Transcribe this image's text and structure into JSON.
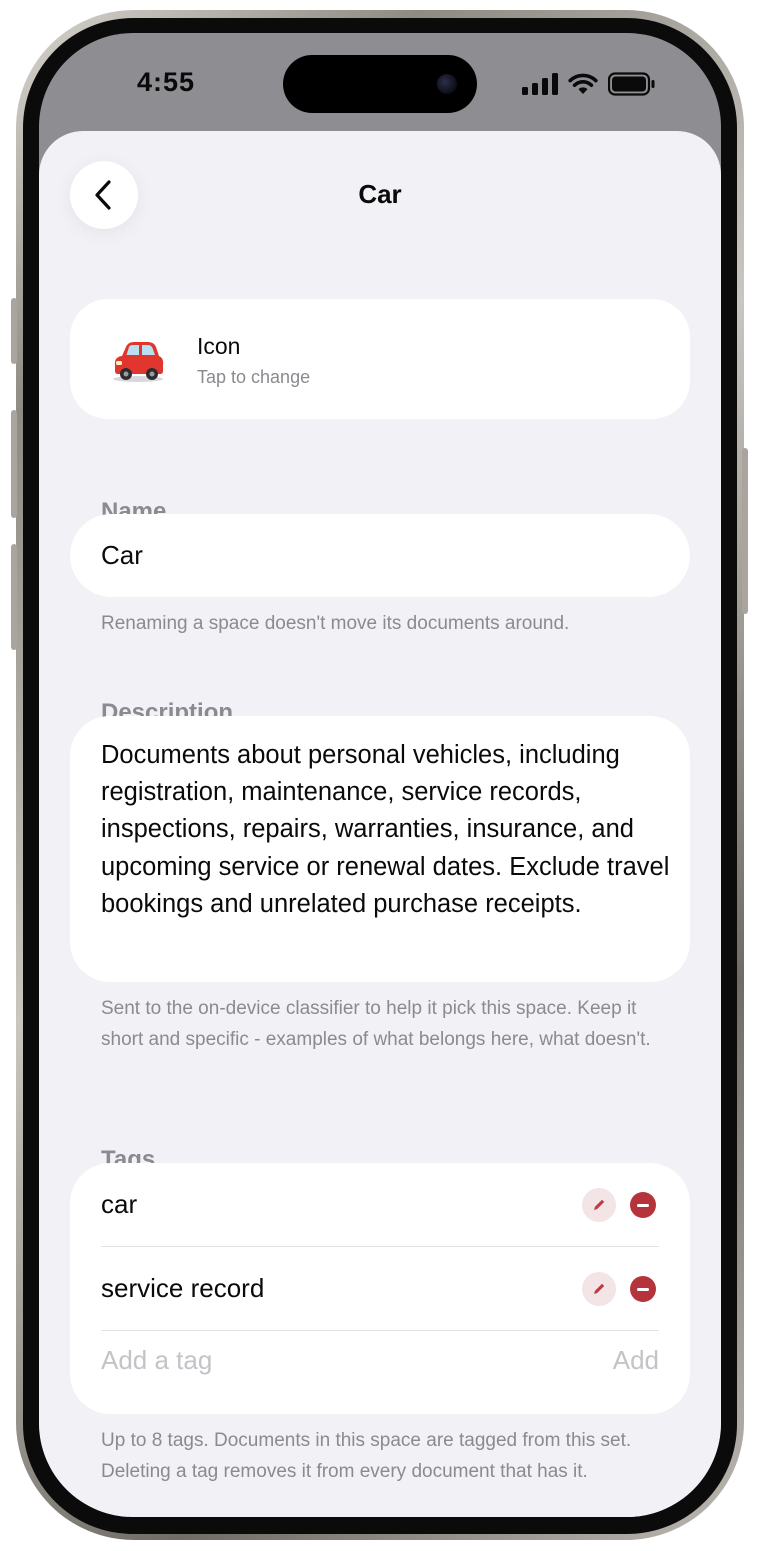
{
  "status_bar": {
    "time": "4:55",
    "icons": [
      "cellular-signal-icon",
      "wifi-icon",
      "battery-icon"
    ]
  },
  "nav": {
    "back_icon": "chevron-left-icon",
    "title": "Car"
  },
  "icon_card": {
    "emoji": "red car",
    "title": "Icon",
    "subtitle": "Tap to change"
  },
  "name_section": {
    "label": "Name",
    "value": "Car",
    "hint": "Renaming a space doesn't move its documents around."
  },
  "description_section": {
    "label": "Description",
    "value": "Documents about personal vehicles, including registration, maintenance, service records, inspections, repairs, warranties, insurance, and upcoming service or renewal dates. Exclude travel bookings and unrelated purchase receipts.",
    "hint": "Sent to the on-device classifier to help it pick this space. Keep it short and specific - examples of what belongs here, what doesn't."
  },
  "tags_section": {
    "label": "Tags",
    "items": [
      {
        "label": "car"
      },
      {
        "label": "service record"
      }
    ],
    "add_placeholder": "Add a tag",
    "add_button": "Add",
    "hint": "Up to 8 tags. Documents in this space are tagged from this set. Deleting a tag removes it from every document that has it."
  },
  "colors": {
    "sheet_background": "#f1f1f6",
    "card_background": "#ffffff",
    "delete_red": "#b5343b",
    "edit_tint": "#f3e4e6",
    "secondary_text": "#8a8a90"
  }
}
